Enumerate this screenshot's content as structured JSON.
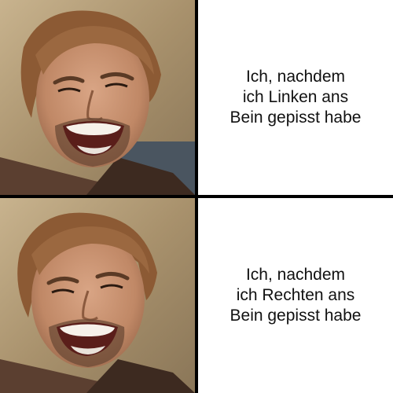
{
  "panels": [
    {
      "caption_lines": [
        "Ich, nachdem",
        "ich Linken ans",
        "Bein gepisst habe"
      ],
      "photo": "smiling-man-photo"
    },
    {
      "caption_lines": [
        "Ich, nachdem",
        "ich Rechten ans",
        "Bein gepisst habe"
      ],
      "photo": "smiling-man-photo"
    }
  ],
  "colors": {
    "divider": "#000000",
    "background": "#ffffff",
    "text": "#111111"
  }
}
